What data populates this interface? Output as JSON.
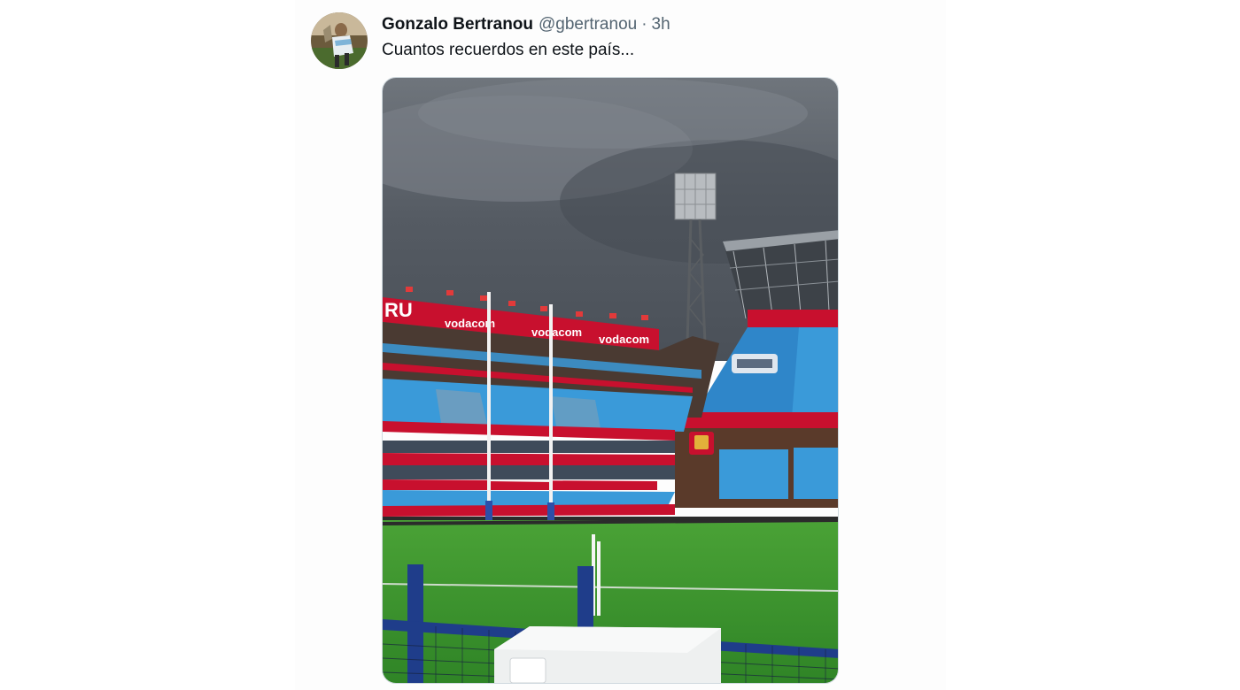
{
  "tweet": {
    "author": {
      "display_name": "Gonzalo Bertranou",
      "handle": "@gbertranou"
    },
    "separator": "·",
    "timestamp": "3h",
    "text": "Cuantos recuerdos en este país...",
    "media": {
      "signage": {
        "brand": "vodacom",
        "partial_left": "RU"
      }
    }
  },
  "colors": {
    "text_primary": "#0f1419",
    "text_secondary": "#536471",
    "sign_red": "#c8102e",
    "seat_blue": "#3a9ad9",
    "grass": "#3e9a2e"
  }
}
